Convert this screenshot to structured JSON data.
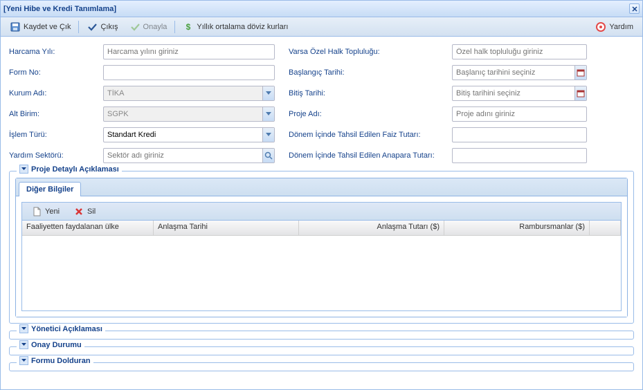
{
  "window": {
    "title": "[Yeni Hibe ve Kredi Tanımlama]"
  },
  "toolbar": {
    "saveExit": "Kaydet ve Çık",
    "exit": "Çıkış",
    "approve": "Onayla",
    "fxRates": "Yıllık ortalama döviz kurları",
    "help": "Yardım"
  },
  "form": {
    "left": {
      "harcamaYili": {
        "label": "Harcama Yılı:",
        "placeholder": "Harcama yılını giriniz"
      },
      "formNo": {
        "label": "Form No:"
      },
      "kurumAdi": {
        "label": "Kurum Adı:",
        "value": "TİKA"
      },
      "altBirim": {
        "label": "Alt Birim:",
        "value": "SGPK"
      },
      "islemTuru": {
        "label": "İşlem Türü:",
        "value": "Standart Kredi"
      },
      "yardimSektoru": {
        "label": "Yardım Sektörü:",
        "placeholder": "Sektör adı giriniz"
      }
    },
    "right": {
      "ozelHalk": {
        "label": "Varsa Özel Halk Topluluğu:",
        "placeholder": "Özel halk topluluğu giriniz"
      },
      "baslangic": {
        "label": "Başlangıç Tarihi:",
        "placeholder": "Başlanıç tarihini seçiniz"
      },
      "bitis": {
        "label": "Bitiş Tarihi:",
        "placeholder": "Bitiş tarihini seçiniz"
      },
      "projeAdi": {
        "label": "Proje Adı:",
        "placeholder": "Proje adını giriniz"
      },
      "faizTutari": {
        "label": "Dönem İçinde Tahsil Edilen Faiz Tutarı:"
      },
      "anaparaTutari": {
        "label": "Dönem İçinde Tahsil Edilen Anapara Tutarı:"
      }
    }
  },
  "sections": {
    "projeDetay": "Proje Detaylı Açıklaması",
    "digerBilgiler": "Diğer Bilgiler",
    "yoneticiAciklamasi": "Yönetici Açıklaması",
    "onayDurumu": "Onay Durumu",
    "formuDolduran": "Formu Dolduran"
  },
  "grid": {
    "new": "Yeni",
    "delete": "Sil",
    "cols": {
      "ulke": "Faaliyetten faydalanan ülke",
      "anlasmaTarihi": "Anlaşma Tarihi",
      "anlasmaTutari": "Anlaşma Tutarı ($)",
      "rambursmanlar": "Rambursmanlar ($)"
    }
  }
}
